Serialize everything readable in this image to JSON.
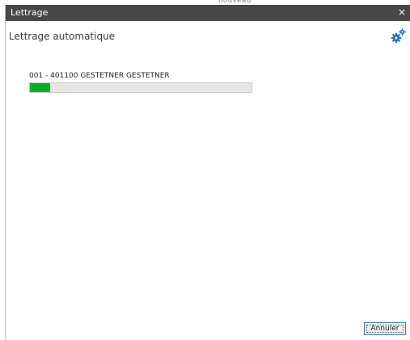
{
  "window": {
    "title": "Lettrage",
    "close_glyph": "×",
    "background_fragment": "nouveau"
  },
  "header": {
    "label": "Lettrage automatique",
    "settings_icon": "gears-icon"
  },
  "task": {
    "label": "001 - 401100 GESTETNER GESTETNER",
    "progress_fraction": 0.09,
    "progress_color": "#06b025"
  },
  "footer": {
    "cancel_label": "Annuler"
  },
  "colors": {
    "titlebar": "#474747",
    "accent": "#1a6fbd"
  }
}
